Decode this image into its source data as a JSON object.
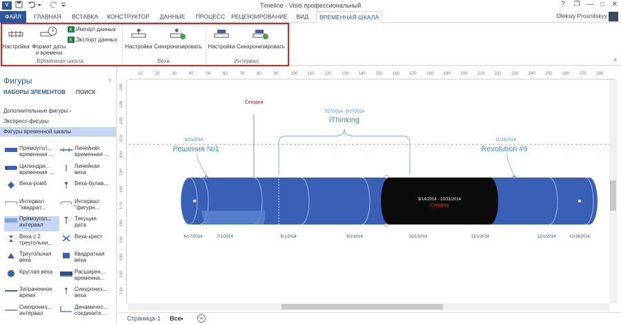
{
  "titlebar": {
    "app_icon": "V",
    "title": "Timeline - Visio профессиональный",
    "help": "?",
    "restore": "❐",
    "minimize": "—",
    "maximize": "□",
    "close": "✕"
  },
  "tabs": [
    "ФАЙЛ",
    "ГЛАВНАЯ",
    "ВСТАВКА",
    "КОНСТРУКТОР",
    "ДАННЫЕ",
    "ПРОЦЕСС",
    "РЕЦЕНЗИРОВАНИЕ",
    "ВИД",
    "ВРЕМЕННАЯ ШКАЛА"
  ],
  "user": "Oleksiy Prosnitskyy",
  "ribbon": {
    "timeline_group": {
      "label": "Временная шкала",
      "settings": "Настройка",
      "date_format_1": "Формат даты",
      "date_format_2": "и времени",
      "import": "Импорт данных",
      "export": "Экспорт данных"
    },
    "milestone_group": {
      "label": "Веха",
      "settings": "Настройка",
      "sync": "Синхронизировать"
    },
    "interval_group": {
      "label": "Интервал",
      "settings": "Настройка",
      "sync": "Синхронизировать"
    }
  },
  "shapes_pane": {
    "title": "Фигуры",
    "collapse": "‹",
    "tab_sets": "НАБОРЫ ЭЛЕМЕНТОВ",
    "tab_search": "ПОИСК",
    "stencils": [
      "Дополнительные фигуры",
      "Экспресс-фигуры",
      "Фигуры временной шкалы"
    ],
    "stencil_arrow": "›",
    "items": [
      {
        "l1": "Прямоугол...",
        "l2": "временная ..."
      },
      {
        "l1": "Линейная",
        "l2": "временная ..."
      },
      {
        "l1": "Цилиндри...",
        "l2": "временная ..."
      },
      {
        "l1": "Линейная",
        "l2": "веха"
      },
      {
        "l1": "Веха-ромб",
        "l2": ""
      },
      {
        "l1": "Веха-булав...",
        "l2": ""
      },
      {
        "l1": "Интервал",
        "l2": "\"квадрат..."
      },
      {
        "l1": "Интервал",
        "l2": "\"фигурн..."
      },
      {
        "l1": "Прямоугол...",
        "l2": "интервал"
      },
      {
        "l1": "Текущая",
        "l2": "дата"
      },
      {
        "l1": "Веха с 2",
        "l2": "треугольни..."
      },
      {
        "l1": "Веха-крест",
        "l2": ""
      },
      {
        "l1": "Треугольная",
        "l2": "веха"
      },
      {
        "l1": "Квадратная",
        "l2": "веха"
      },
      {
        "l1": "Круглая веха",
        "l2": ""
      },
      {
        "l1": "Расширен...",
        "l2": "временна..."
      },
      {
        "l1": "Затраченное",
        "l2": "время"
      },
      {
        "l1": "Синхрониз...",
        "l2": "веха"
      },
      {
        "l1": "Синхрониз...",
        "l2": "интервал"
      },
      {
        "l1": "Динамичес...",
        "l2": "соедините..."
      }
    ]
  },
  "ruler": {
    "top_ticks": [
      "10",
      "20",
      "30",
      "40",
      "50",
      "60",
      "70",
      "80",
      "90",
      "100",
      "110",
      "120",
      "130",
      "140",
      "150",
      "160",
      "170",
      "180",
      "190",
      "200",
      "210",
      "220",
      "230",
      "240",
      "250",
      "260",
      "270",
      "280"
    ],
    "left_ticks": [
      "240",
      "230",
      "220",
      "210",
      "200",
      "190",
      "180",
      "170",
      "160",
      "150",
      "140",
      "130",
      "120",
      "110",
      "100",
      "90",
      "80",
      "70",
      "60",
      "50",
      "40",
      "30"
    ]
  },
  "timeline": {
    "today_label": "Сегодня",
    "milestone_1": {
      "date": "6/23/2014",
      "label": "Решения №1"
    },
    "milestone_2": {
      "date": "11/15/2014",
      "label": "Revolution #9"
    },
    "interval_top": {
      "dates": "7/27/2014 - 9/27/2014",
      "label": "iThinking"
    },
    "interval_dark": {
      "dates": "9/14/2014 - 10/31/2014",
      "label": "Creating"
    },
    "axis_dates": [
      "6/17/2014",
      "7/1/2014",
      "8/1/2014",
      "9/1/2014",
      "10/1/2014",
      "11/1/2014",
      "12/1/2014",
      "12/16/2014"
    ],
    "colors": {
      "bar": "#3960b4",
      "dark": "#0b0b0b",
      "label_blue": "#3f8bc4",
      "today_red": "#a02020",
      "creating_red": "#ff2a2a"
    }
  },
  "pagebar": {
    "page_tab": "Страница-1",
    "all_tab": "Все",
    "add": "+"
  }
}
